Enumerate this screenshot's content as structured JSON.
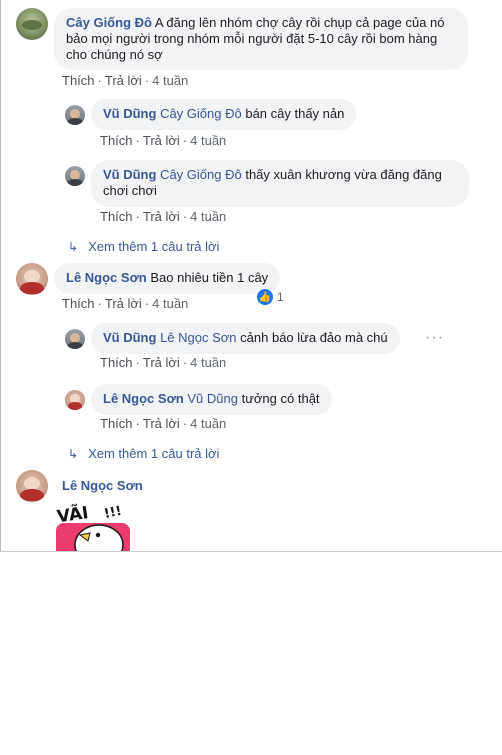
{
  "colors": {
    "link": "#385898",
    "bubble": "#f2f3f5",
    "meta": "#606770",
    "like": "#1877f2"
  },
  "comments": [
    {
      "author": "Cây Giống Đô",
      "text": "A đăng lên nhóm chợ cây rồi chụp cả page của nó bảo mọi người trong nhóm mỗi người đặt 5-10 cây rồi bom hàng cho chúng nó sợ",
      "like": "Thích",
      "reply": "Trả lời",
      "time": "4 tuần"
    },
    {
      "author": "Vũ Dũng",
      "tag": "Cây Giống Đô",
      "text": "bán cây thấy nản",
      "like": "Thích",
      "reply": "Trả lời",
      "time": "4 tuần"
    },
    {
      "author": "Vũ Dũng",
      "tag": "Cây Giống Đô",
      "text": "thấy xuân khương vừa đăng đăng chơi chơi",
      "like": "Thích",
      "reply": "Trả lời",
      "time": "4 tuần"
    },
    {
      "author": "Lê Ngọc Sơn",
      "text": "Bao nhiêu tiền 1 cây",
      "like": "Thích",
      "reply": "Trả lời",
      "time": "4 tuần",
      "reactions": "1"
    },
    {
      "author": "Vũ Dũng",
      "tag": "Lê Ngọc Sơn",
      "text": "cảnh báo lừa đảo mà chú",
      "like": "Thích",
      "reply": "Trả lời",
      "time": "4 tuần"
    },
    {
      "author": "Lê Ngọc Sơn",
      "tag": "Vũ Dũng",
      "text": "tưởng có thật",
      "like": "Thích",
      "reply": "Trả lời",
      "time": "4 tuần"
    },
    {
      "author": "Lê Ngọc Sơn",
      "sticker_text": "VÃI !!!"
    }
  ],
  "view_more": [
    "Xem thêm 1 câu trả lời",
    "Xem thêm 1 câu trả lời"
  ],
  "icons": {
    "more_replies": "reply-arrow-icon",
    "like": "like-icon",
    "options": "more-options-icon"
  }
}
